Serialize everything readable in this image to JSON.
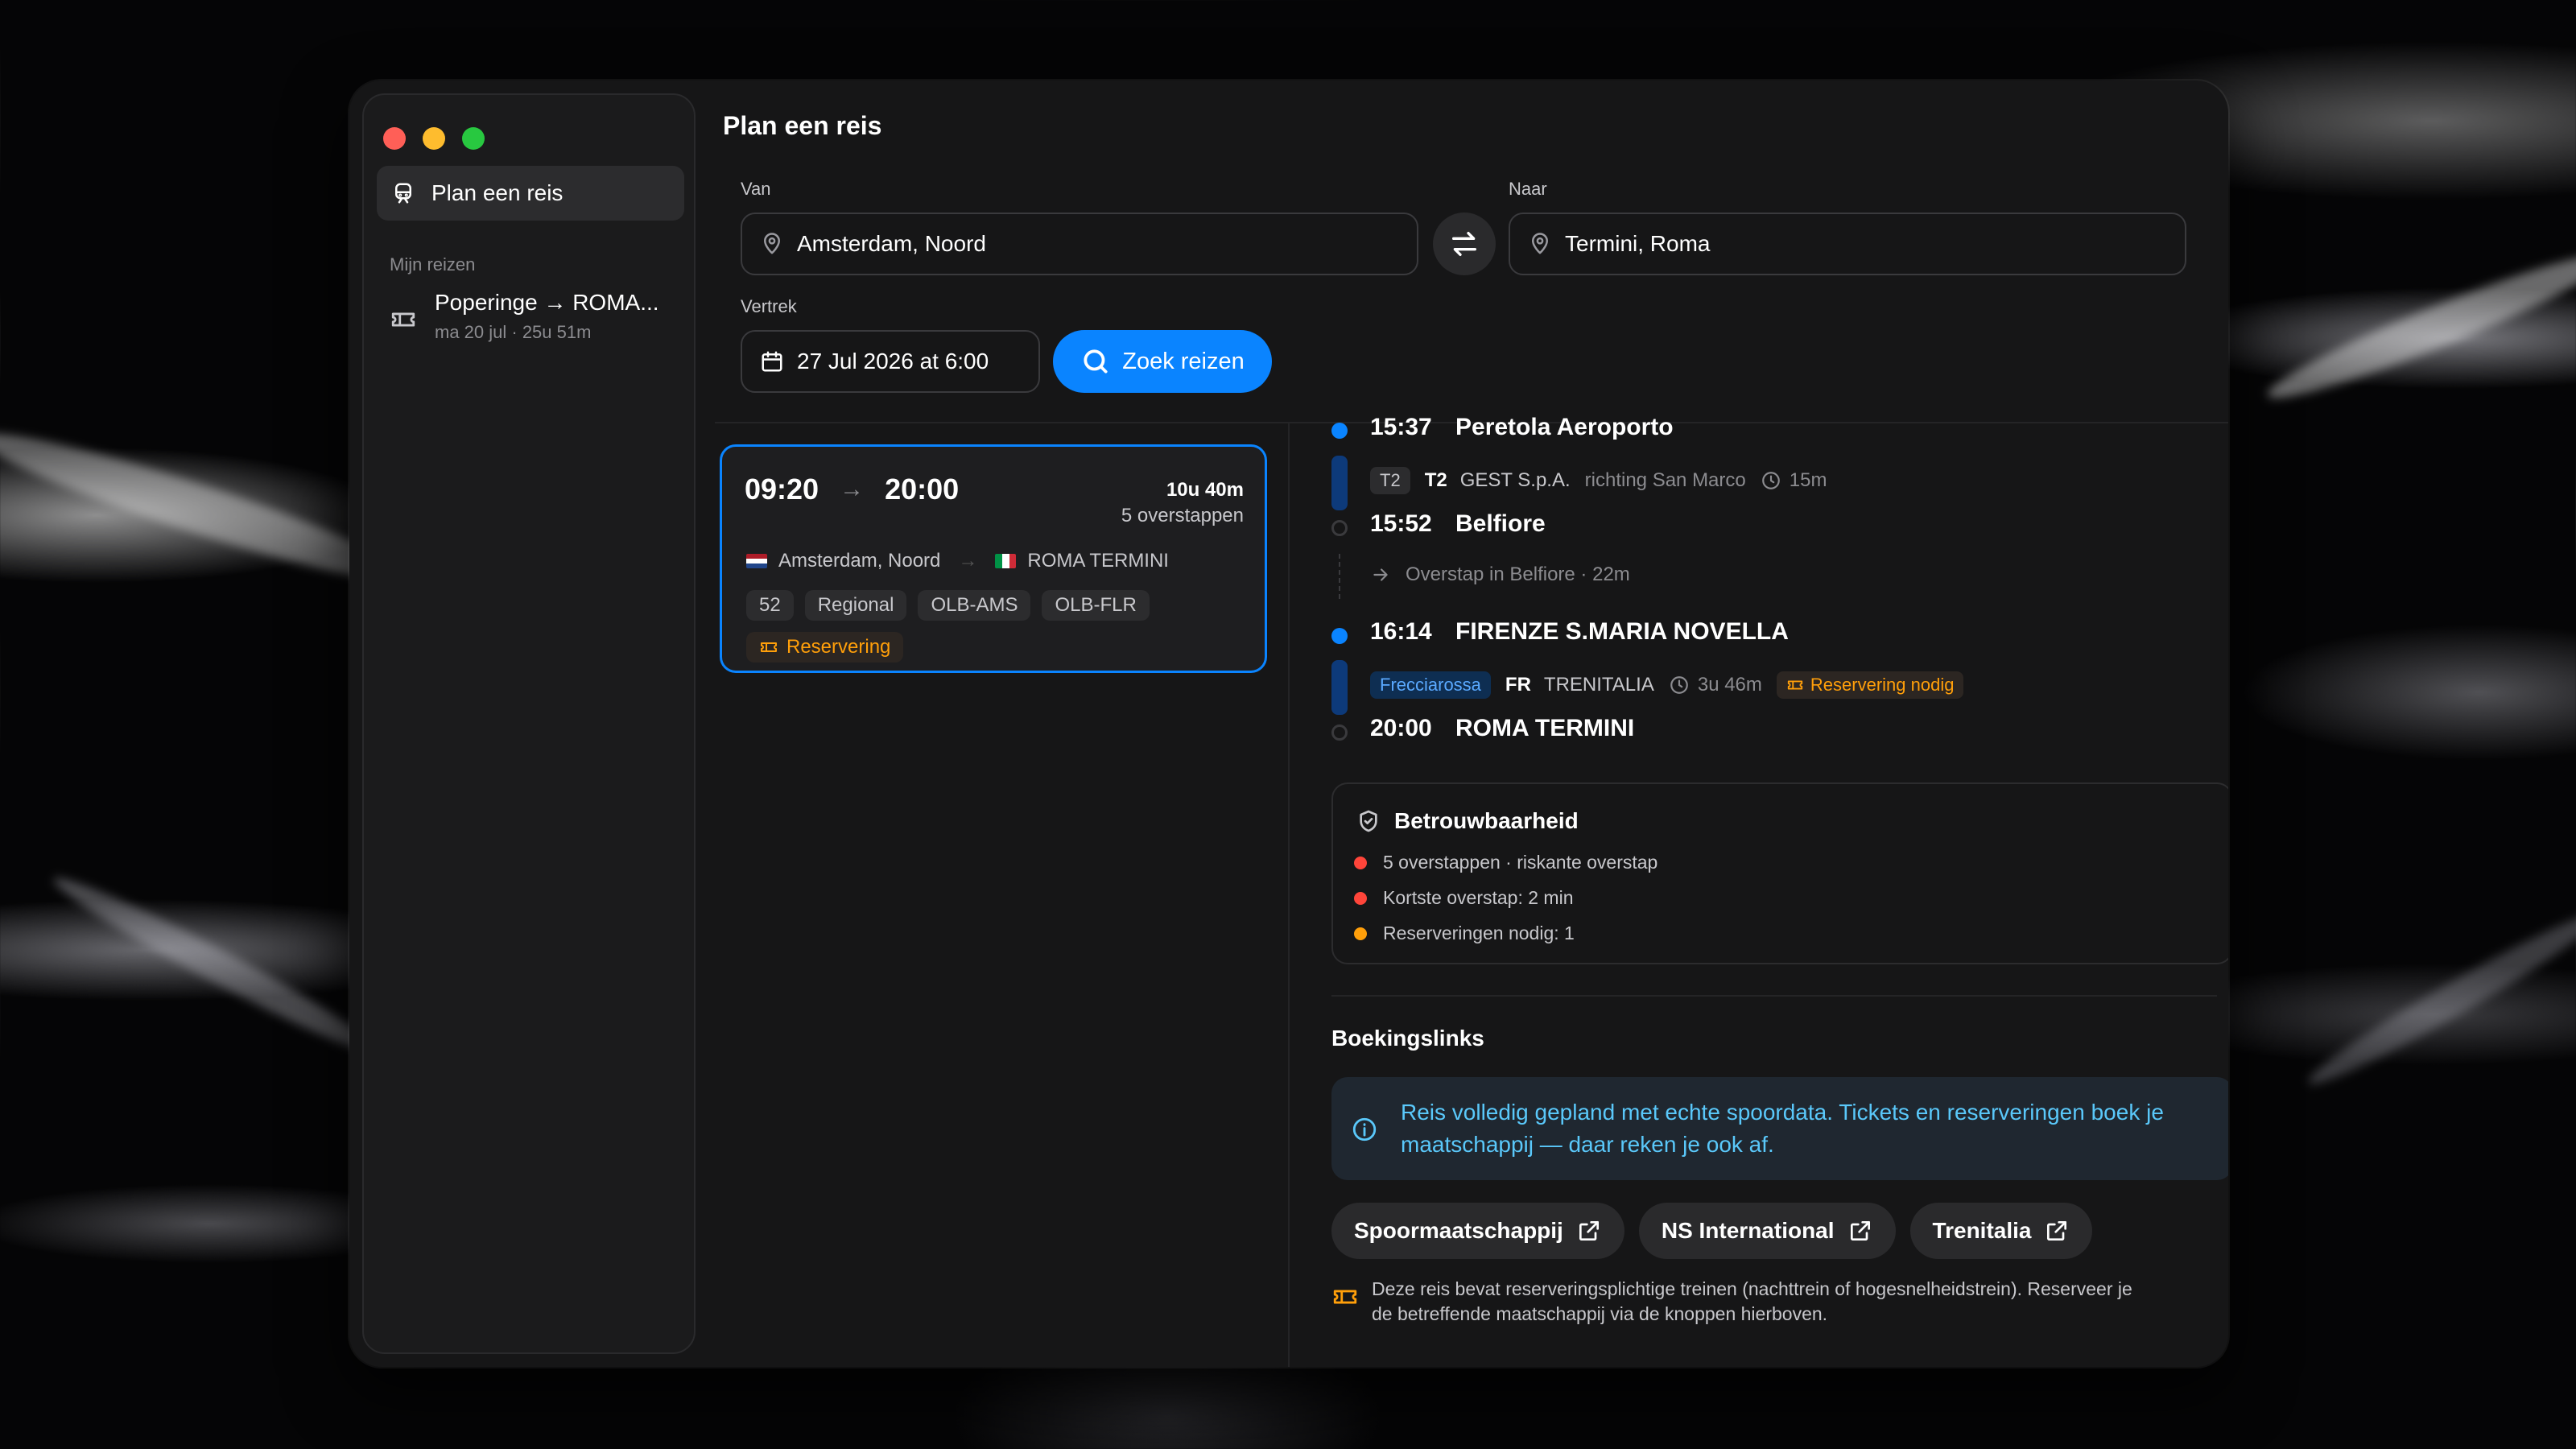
{
  "sidebar": {
    "nav_item": "Plan een reis",
    "section_heading": "Mijn reizen",
    "trip": {
      "title": "Poperinge → ROMA...",
      "subtitle": "ma 20 jul · 25u 51m"
    }
  },
  "header": {
    "title": "Plan een reis"
  },
  "form": {
    "from_label": "Van",
    "from_value": "Amsterdam, Noord",
    "to_label": "Naar",
    "to_value": "Termini, Roma",
    "departure_label": "Vertrek",
    "departure_value": "27 Jul 2026 at 6:00",
    "search_label": "Zoek reizen"
  },
  "result": {
    "depart": "09:20",
    "arrive": "20:00",
    "duration": "10u 40m",
    "transfers": "5 overstappen",
    "from": "Amsterdam, Noord",
    "to": "ROMA TERMINI",
    "tags": [
      "52",
      "Regional",
      "OLB-AMS",
      "OLB-FLR"
    ],
    "reservation": "Reservering"
  },
  "timeline": {
    "stop1": {
      "time": "15:37",
      "station": "Peretola Aeroporto"
    },
    "leg1": {
      "line_pill": "T2",
      "line": "T2",
      "operator": "GEST S.p.A.",
      "direction": "richting San Marco",
      "duration": "15m"
    },
    "stop2": {
      "time": "15:52",
      "station": "Belfiore"
    },
    "transfer": "Overstap in Belfiore · 22m",
    "stop3": {
      "time": "16:14",
      "station": "FIRENZE S.MARIA NOVELLA"
    },
    "leg2": {
      "train_pill": "Frecciarossa",
      "line": "FR",
      "operator": "TRENITALIA",
      "duration": "3u 46m",
      "reservation": "Reservering nodig"
    },
    "stop4": {
      "time": "20:00",
      "station": "ROMA TERMINI"
    }
  },
  "reliability": {
    "title": "Betrouwbaarheid",
    "items": [
      {
        "text": "5 overstappen · riskante overstap",
        "color": "#ff453a"
      },
      {
        "text": "Kortste overstap: 2 min",
        "color": "#ff453a"
      },
      {
        "text": "Reserveringen nodig: 1",
        "color": "#ff9f0a"
      }
    ]
  },
  "booking": {
    "title": "Boekingslinks",
    "info_line1": "Reis volledig gepland met echte spoordata. Tickets en reserveringen boek je",
    "info_line2": "maatschappij — daar reken je ook af.",
    "links": [
      "Spoormaatschappij",
      "NS International",
      "Trenitalia"
    ],
    "note_line1": "Deze reis bevat reserveringsplichtige treinen (nachttrein of hogesnelheidstrein). Reserveer je",
    "note_line2": "de betreffende maatschappij via de knoppen hierboven."
  },
  "colors": {
    "accent": "#0a84ff",
    "warning": "#ff9f0a",
    "danger": "#ff453a",
    "info": "#5ac8fa"
  }
}
